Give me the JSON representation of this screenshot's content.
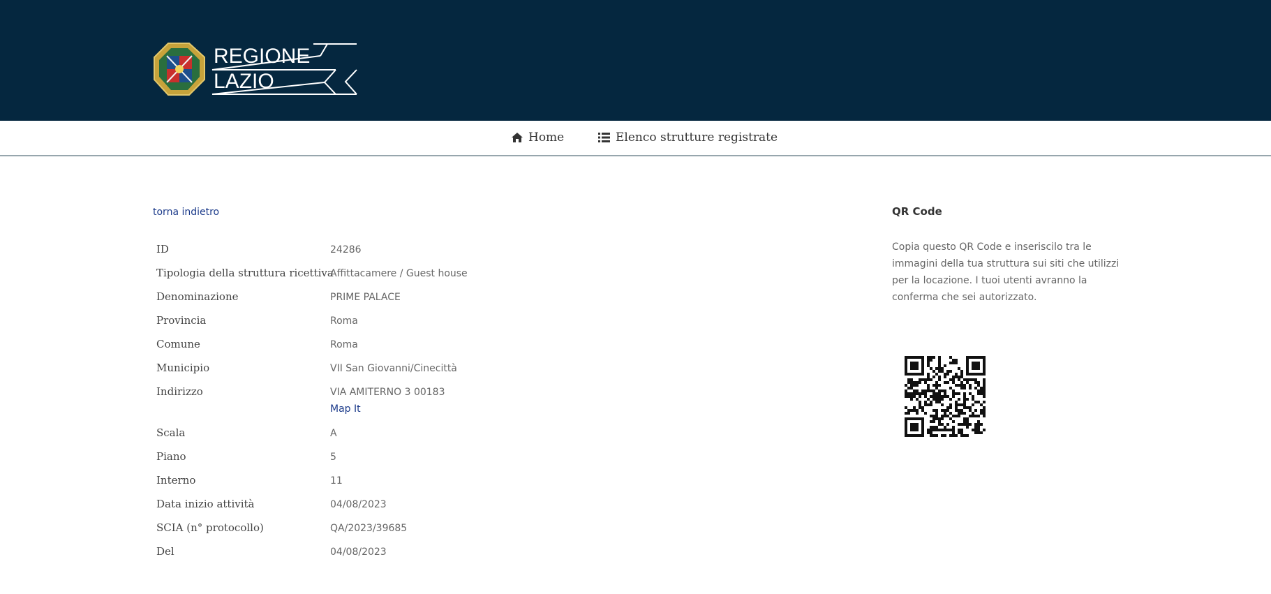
{
  "header": {
    "logo_line1": "REGIONE",
    "logo_line2": "LAZIO",
    "background_color": "#05273f"
  },
  "nav": {
    "home_icon": "home-icon",
    "home_label": "Home",
    "list_icon": "list-icon",
    "list_label": "Elenco strutture registrate"
  },
  "back_link": "torna indietro",
  "details": [
    {
      "label": "ID",
      "value": "24286"
    },
    {
      "label": "Tipologia della struttura ricettiva",
      "value": "Affittacamere / Guest house"
    },
    {
      "label": "Denominazione",
      "value": "PRIME PALACE"
    },
    {
      "label": "Provincia",
      "value": "Roma"
    },
    {
      "label": "Comune",
      "value": "Roma"
    },
    {
      "label": "Municipio",
      "value": "VII San Giovanni/Cinecittà"
    },
    {
      "label": "Indirizzo",
      "value": "VIA AMITERNO 3 00183",
      "link": "Map It"
    },
    {
      "label": "Scala",
      "value": "A"
    },
    {
      "label": "Piano",
      "value": "5"
    },
    {
      "label": "Interno",
      "value": "11"
    },
    {
      "label": "Data inizio attività",
      "value": "04/08/2023"
    },
    {
      "label": "SCIA (n° protocollo)",
      "value": "QA/2023/39685"
    },
    {
      "label": "Del",
      "value": "04/08/2023"
    }
  ],
  "qr": {
    "title": "QR Code",
    "description": "Copia questo QR Code e inseriscilo tra le immagini della tua struttura sui siti che utilizzi per la locazione. I tuoi utenti avranno la conferma che sei autorizzato."
  }
}
